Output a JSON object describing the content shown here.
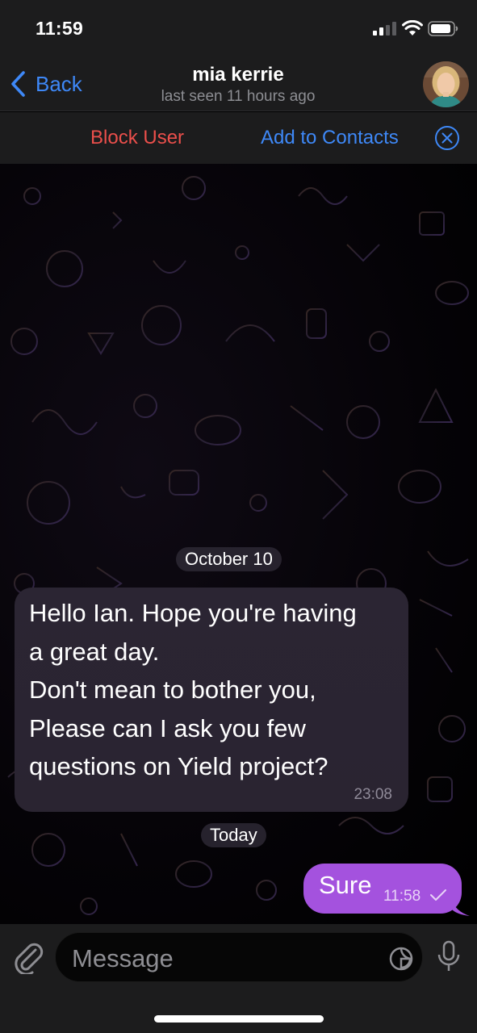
{
  "status_bar": {
    "time": "11:59",
    "icons": [
      "signal-icon",
      "wifi-icon",
      "battery-icon"
    ]
  },
  "header": {
    "back_label": "Back",
    "contact_name": "mia kerrie",
    "last_seen": "last seen 11 hours ago"
  },
  "action_bar": {
    "block_label": "Block User",
    "add_contact_label": "Add to Contacts"
  },
  "messages": [
    {
      "type": "date",
      "text": "October 10"
    },
    {
      "type": "incoming",
      "text": "Hello Ian. Hope you're having\na great day.\nDon't mean to bother you,\nPlease can I ask you few\nquestions on Yield project?",
      "time": "23:08"
    },
    {
      "type": "date",
      "text": "Today"
    },
    {
      "type": "outgoing",
      "text": "Sure",
      "time": "11:58",
      "status": "sent"
    }
  ],
  "input": {
    "placeholder": "Message"
  },
  "colors": {
    "accent": "#3e88f7",
    "danger": "#eb4f4b",
    "outgoing_bubble": "#a452de",
    "incoming_bubble": "#2b2533"
  }
}
